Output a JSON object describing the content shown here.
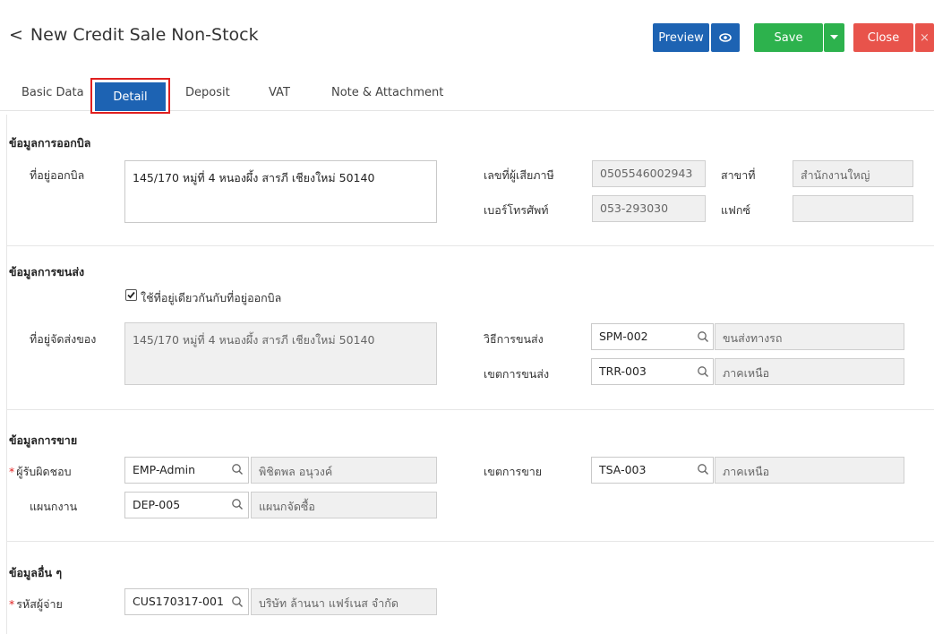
{
  "header": {
    "back_icon": "chevron-left-icon",
    "title": "New Credit Sale Non-Stock",
    "preview_label": "Preview",
    "save_label": "Save",
    "close_label": "Close",
    "colors": {
      "primary": "#1d63b3",
      "success": "#2db24d",
      "danger": "#e8534b",
      "highlight": "#e02020"
    }
  },
  "tabs": [
    {
      "label": "Basic Data"
    },
    {
      "label": "Detail"
    },
    {
      "label": "Deposit"
    },
    {
      "label": "VAT"
    },
    {
      "label": "Note & Attachment"
    }
  ],
  "billing": {
    "title": "ข้อมูลการออกบิล",
    "address_label": "ที่อยู่ออกบิล",
    "address_value": "145/170 หมู่ที่ 4   หนองผึ้ง สารภี เชียงใหม่ 50140",
    "taxid_label": "เลขที่ผู้เสียภาษี",
    "taxid_value": "0505546002943",
    "branch_label": "สาขาที่",
    "branch_value": "สำนักงานใหญ่",
    "phone_label": "เบอร์โทรศัพท์",
    "phone_value": "053-293030",
    "fax_label": "แฟกซ์",
    "fax_value": ""
  },
  "shipping": {
    "title": "ข้อมูลการขนส่ง",
    "same_address_label": "ใช้ที่อยู่เดียวกันกับที่อยู่ออกบิล",
    "address_label": "ที่อยู่จัดส่งของ",
    "address_value": "145/170 หมู่ที่ 4   หนองผึ้ง สารภี เชียงใหม่ 50140",
    "method_label": "วิธีการขนส่ง",
    "method_code": "SPM-002",
    "method_name": "ขนส่งทางรถ",
    "zone_label": "เขตการขนส่ง",
    "zone_code": "TRR-003",
    "zone_name": "ภาคเหนือ"
  },
  "sales": {
    "title": "ข้อมูลการขาย",
    "owner_label": "ผู้รับผิดชอบ",
    "owner_code": "EMP-Admin",
    "owner_name": "พิชิตพล อนุวงค์",
    "dept_label": "แผนกงาน",
    "dept_code": "DEP-005",
    "dept_name": "แผนกจัดซื้อ",
    "zone_label": "เขตการขาย",
    "zone_code": "TSA-003",
    "zone_name": "ภาคเหนือ"
  },
  "other": {
    "title": "ข้อมูลอื่น ๆ",
    "payer_label": "รหัสผู้จ่าย",
    "payer_code": "CUS170317-001",
    "payer_name": "บริษัท ล้านนา แฟร์เนส จำกัด"
  }
}
